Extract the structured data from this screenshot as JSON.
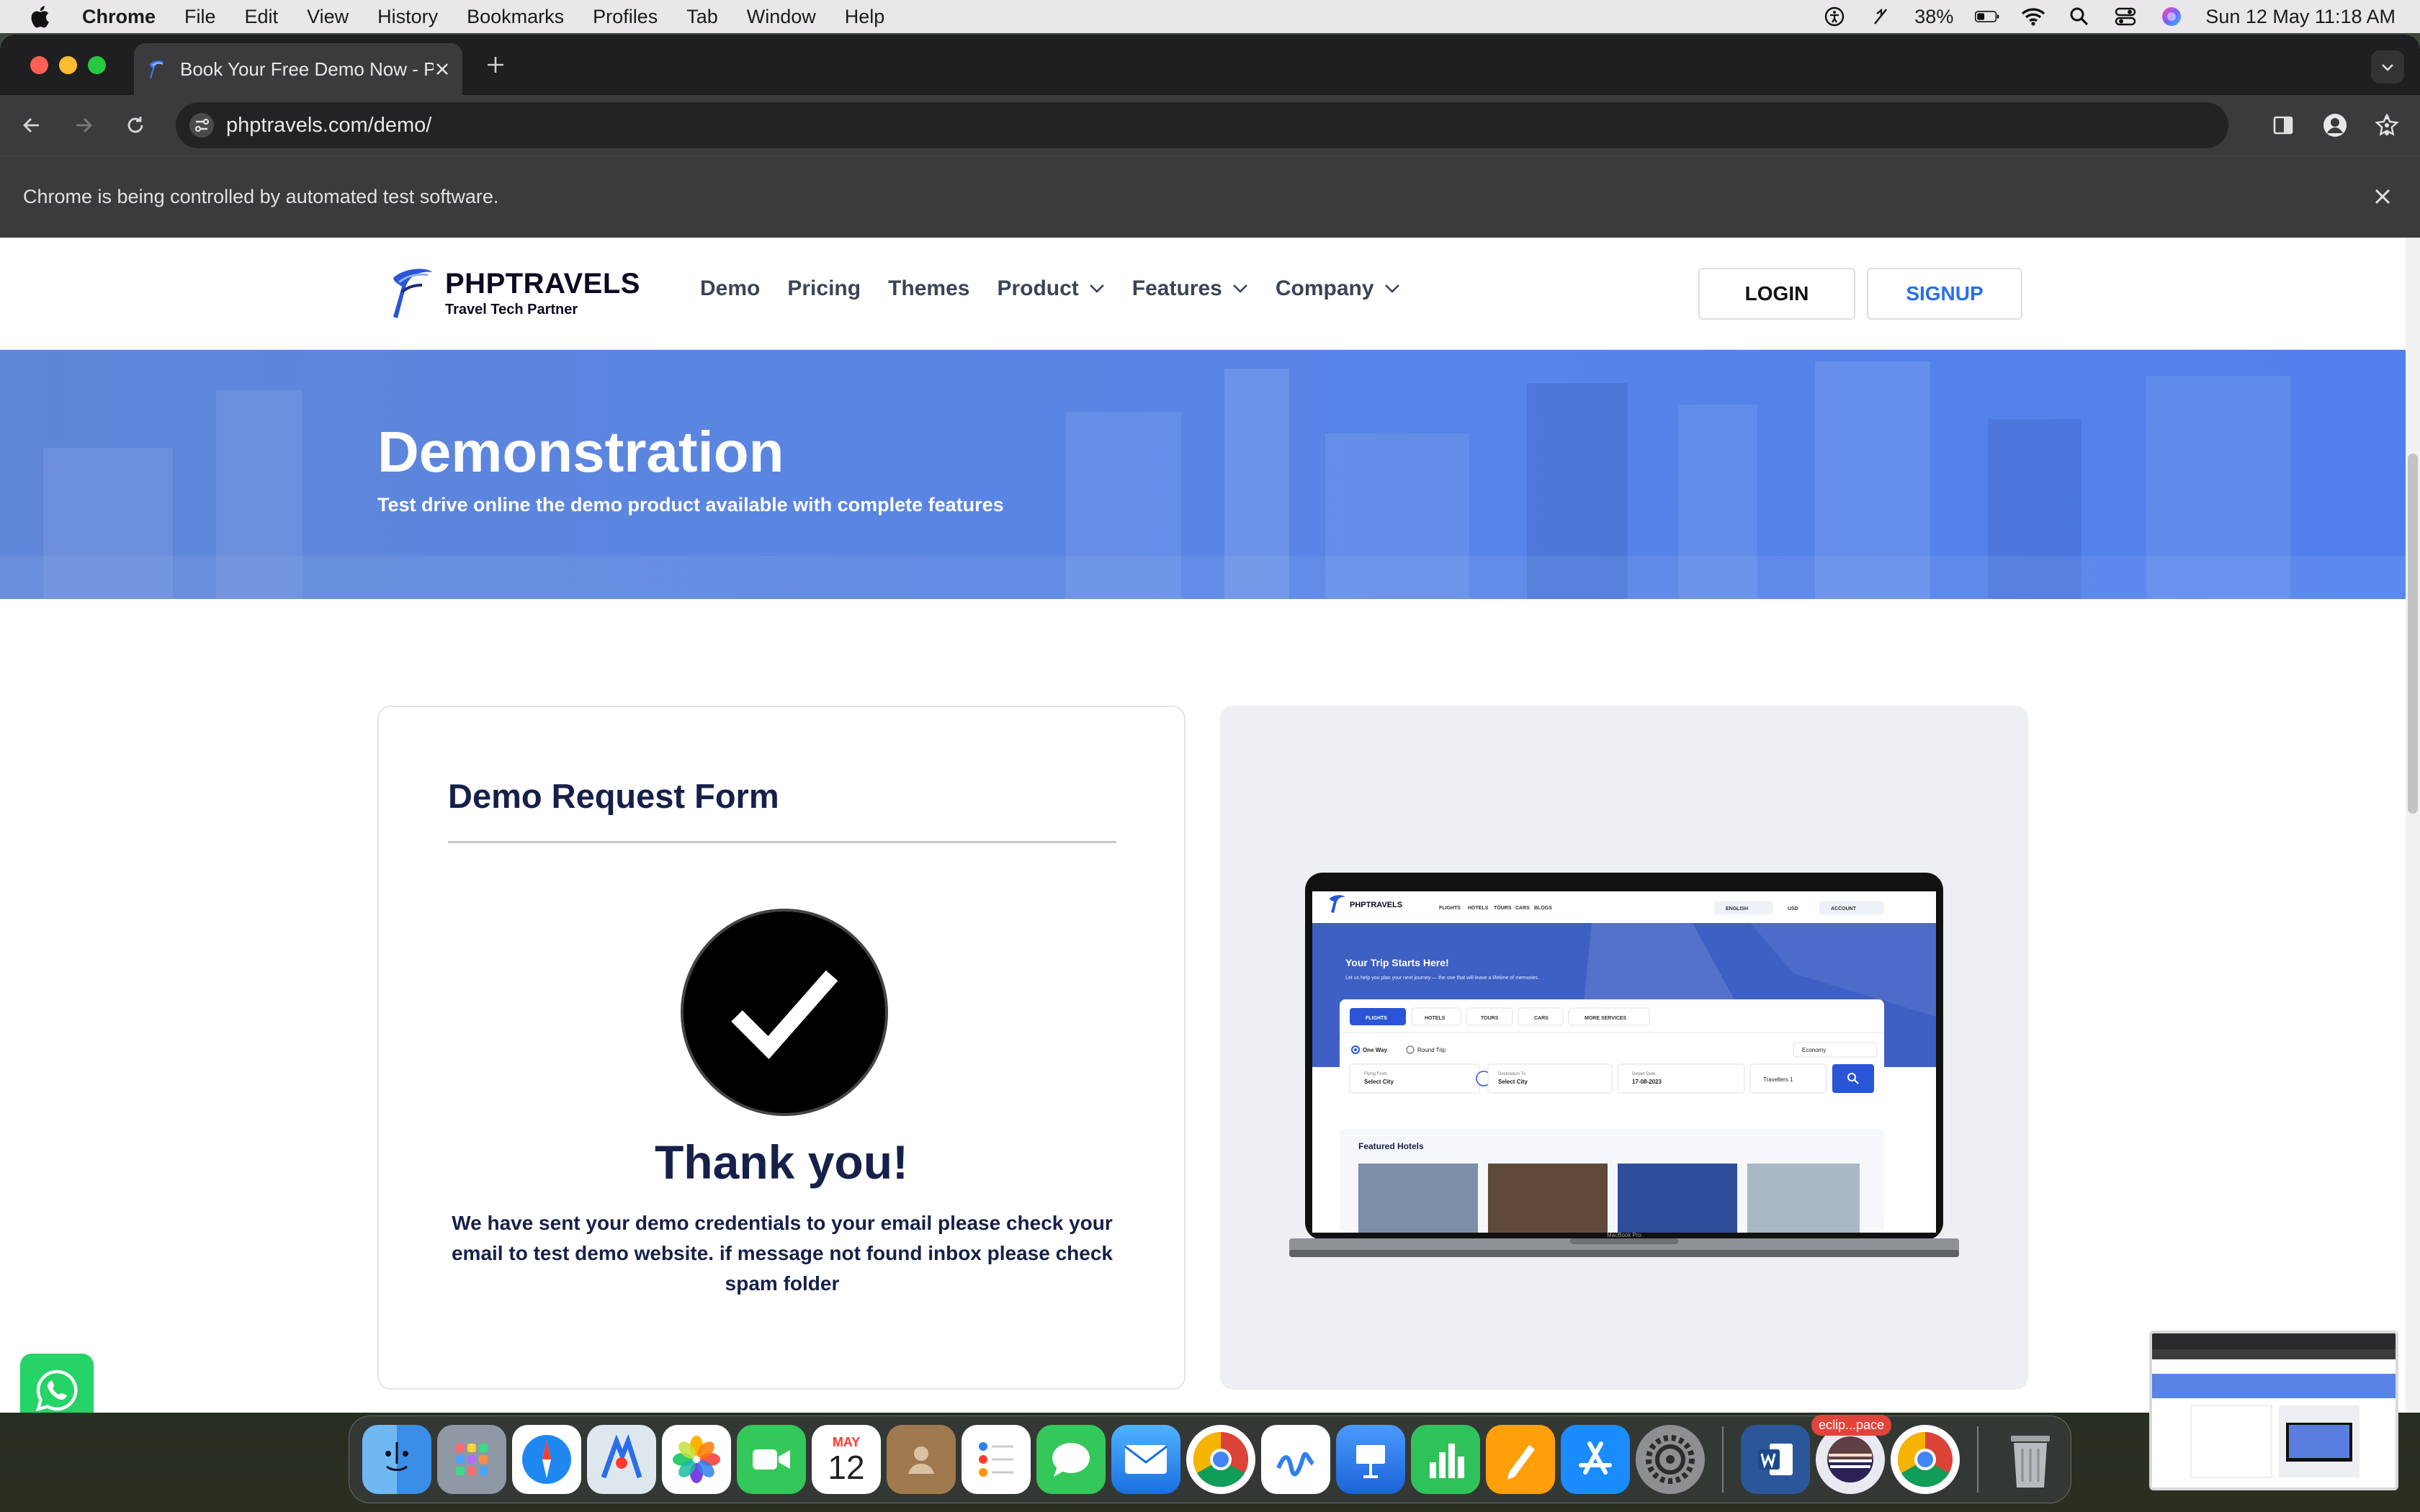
{
  "menubar": {
    "app": "Chrome",
    "items": [
      "File",
      "Edit",
      "View",
      "History",
      "Bookmarks",
      "Profiles",
      "Tab",
      "Window",
      "Help"
    ],
    "battery": "38%",
    "datetime": "Sun 12 May  11:18 AM"
  },
  "browser": {
    "tab_title": "Book Your Free Demo Now - P",
    "url": "phptravels.com/demo/",
    "automation_notice": "Chrome is being controlled by automated test software."
  },
  "site": {
    "logo_name": "PHPTRAVELS",
    "logo_tagline": "Travel Tech Partner",
    "nav": [
      {
        "label": "Demo"
      },
      {
        "label": "Pricing"
      },
      {
        "label": "Themes"
      },
      {
        "label": "Product"
      },
      {
        "label": "Features"
      },
      {
        "label": "Company"
      }
    ],
    "login_label": "LOGIN",
    "signup_label": "SIGNUP",
    "hero_title": "Demonstration",
    "hero_subtitle": "Test drive online the demo product available with complete features",
    "form_title": "Demo Request Form",
    "thanks_title": "Thank you!",
    "thanks_message": "We have sent your demo credentials to your email please check your email to test demo website. if message not found inbox please check spam folder"
  },
  "preview": {
    "logo": "PHPTRAVELS",
    "nav": [
      "FLIGHTS",
      "HOTELS",
      "TOURS",
      "CARS",
      "BLOGS"
    ],
    "lang": "ENGLISH",
    "currency": "USD",
    "account": "ACCOUNT",
    "headline": "Your Trip Starts Here!",
    "subline": "Let us help you plan your next journey — the one that will leave a lifetime of memories.",
    "tabs": [
      "FLIGHTS",
      "HOTELS",
      "TOURS",
      "CARS",
      "MORE SERVICES"
    ],
    "trip_one": "One Way",
    "trip_round": "Round Trip",
    "cabin": "Economy",
    "from_label": "Flying From",
    "from_value": "Select City",
    "to_label": "Destination To",
    "to_value": "Select City",
    "date_label": "Depart Date",
    "date_value": "17-08-2023",
    "travellers": "Travellers 1",
    "featured": "Featured Hotels",
    "device": "MacBook Pro"
  },
  "dock": {
    "calendar_month": "MAY",
    "calendar_day": "12",
    "eclipse_badge": "eclip...pace"
  },
  "colors": {
    "brand_blue": "#2a6ee8",
    "hero_blue": "#5885e6",
    "navy": "#16204a",
    "whatsapp": "#25d366"
  }
}
